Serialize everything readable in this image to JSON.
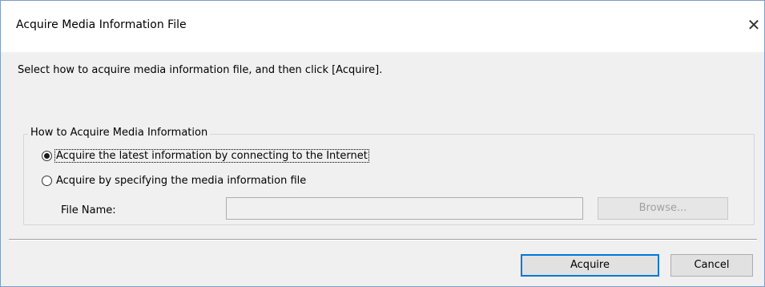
{
  "window": {
    "title": "Acquire Media Information File",
    "close_icon": "close-icon",
    "close_glyph": "✕"
  },
  "instruction": "Select how to acquire media information file, and then click [Acquire].",
  "group": {
    "label": "How to Acquire Media Information",
    "options": [
      {
        "label": "Acquire the latest information by connecting to the Internet",
        "checked": true
      },
      {
        "label": "Acquire by specifying the media information file",
        "checked": false
      }
    ],
    "file_name_label": "File Name:",
    "file_name_value": "",
    "browse_label": "Browse..."
  },
  "buttons": {
    "acquire": "Acquire",
    "cancel": "Cancel"
  },
  "colors": {
    "dialog_bg": "#f0f0f0",
    "focus_border": "#0078d7",
    "disabled_text": "#a0a0a0"
  }
}
